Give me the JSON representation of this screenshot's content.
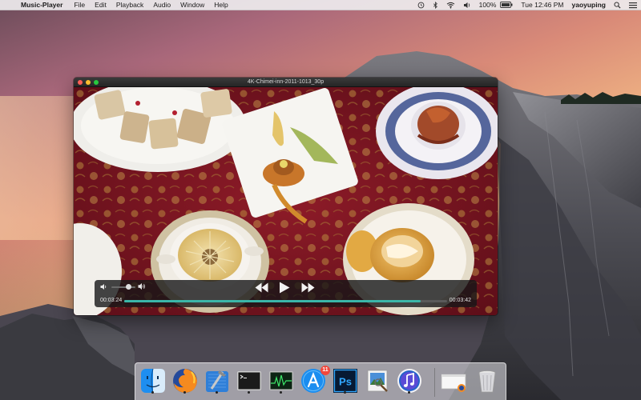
{
  "menubar": {
    "app_name": "Music-Player",
    "menus": [
      "File",
      "Edit",
      "Playback",
      "Audio",
      "Window",
      "Help"
    ],
    "status": {
      "battery": "100%",
      "clock": "Tue 12:46 PM",
      "user": "yaoyuping"
    }
  },
  "player": {
    "title": "4K-Chimei-inn-2011-1013_30p",
    "time_elapsed": "00:03:24",
    "time_total": "00:03:42",
    "progress": 0.919,
    "volume": 0.7,
    "accent_color": "#3bb6a9"
  },
  "dock": {
    "items": [
      "finder-icon",
      "firefox-icon",
      "xcode-icon",
      "terminal-icon",
      "activity-monitor-icon",
      "app-store-icon",
      "photoshop-icon",
      "preview-icon",
      "itunes-icon",
      "firefox-document-icon",
      "trash-icon"
    ],
    "app_store_badge": "11",
    "photoshop_label": "Ps"
  }
}
